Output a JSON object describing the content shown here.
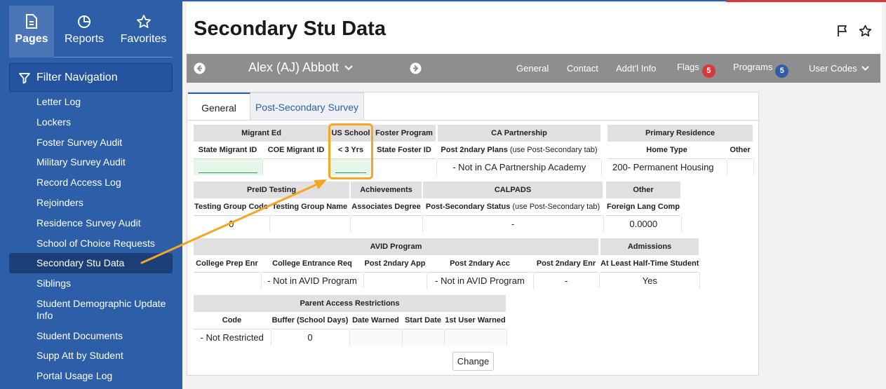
{
  "sidebar": {
    "top_tabs": [
      {
        "label": "Pages",
        "icon": "page-icon"
      },
      {
        "label": "Reports",
        "icon": "pie-chart-icon"
      },
      {
        "label": "Favorites",
        "icon": "star-icon"
      }
    ],
    "filter_label": "Filter Navigation",
    "items": [
      "Letter Log",
      "Lockers",
      "Foster Survey Audit",
      "Military Survey Audit",
      "Record Access Log",
      "Rejoinders",
      "Residence Survey Audit",
      "School of Choice Requests",
      "Secondary Stu Data",
      "Siblings",
      "Student Demographic Update Info",
      "Student Documents",
      "Supp Att by Student",
      "Portal Usage Log"
    ],
    "active_item": "Secondary Stu Data"
  },
  "header": {
    "title": "Secondary Stu Data"
  },
  "student_bar": {
    "name": "Alex (AJ) Abbott",
    "links": {
      "general": "General",
      "contact": "Contact",
      "addtl_info": "Addt'l Info",
      "flags": "Flags",
      "flags_count": "5",
      "programs": "Programs",
      "programs_count": "5",
      "user_codes": "User Codes"
    }
  },
  "tabs": {
    "general": "General",
    "survey": "Post-Secondary Survey"
  },
  "migrant": {
    "title": "Migrant Ed",
    "col1": "State Migrant ID",
    "col2": "COE Migrant ID",
    "us_title": "US School",
    "us_col": "< 3 Yrs",
    "foster_title": "Foster Program",
    "foster_col": "State Foster ID"
  },
  "ca_partnership": {
    "title": "CA Partnership",
    "col": "Post 2ndary Plans",
    "col_note": "(use Post-Secondary tab)",
    "value": "- Not in CA Partnership Academy"
  },
  "residence": {
    "title": "Primary Residence",
    "col1": "Home Type",
    "col2": "Other",
    "value1": "200- Permanent Housing"
  },
  "preid": {
    "title": "PreID Testing",
    "col1": "Testing Group Code",
    "col2": "Testing Group Name",
    "value1": "0"
  },
  "achievements": {
    "title": "Achievements",
    "col": "Associates Degree"
  },
  "calpads": {
    "title": "CALPADS",
    "col": "Post-Secondary Status",
    "col_note": "(use Post-Secondary tab)",
    "value": "-"
  },
  "other": {
    "title": "Other",
    "col": "Foreign Lang Comp",
    "value": "0.0000"
  },
  "avid": {
    "title": "AVID Program",
    "cols": [
      "College Prep Enr",
      "College Entrance Req",
      "Post 2ndary App",
      "Post 2ndary Acc",
      "Post 2ndary Enr"
    ],
    "values": [
      "",
      "- Not in AVID Program",
      "",
      "- Not in AVID Program",
      "-"
    ]
  },
  "admissions": {
    "title": "Admissions",
    "col": "At Least Half-Time Student",
    "value": "Yes"
  },
  "parent_access": {
    "title": "Parent Access Restrictions",
    "cols": [
      "Code",
      "Buffer (School Days)",
      "Date Warned",
      "Start Date",
      "1st User Warned"
    ],
    "values": [
      "- Not Restricted",
      "0",
      "",
      "",
      ""
    ]
  },
  "change_button": "Change",
  "accent_colors": {
    "sidebar": "#2d5ea8",
    "highlight": "#f5a623",
    "badge_red": "#d9383a"
  }
}
